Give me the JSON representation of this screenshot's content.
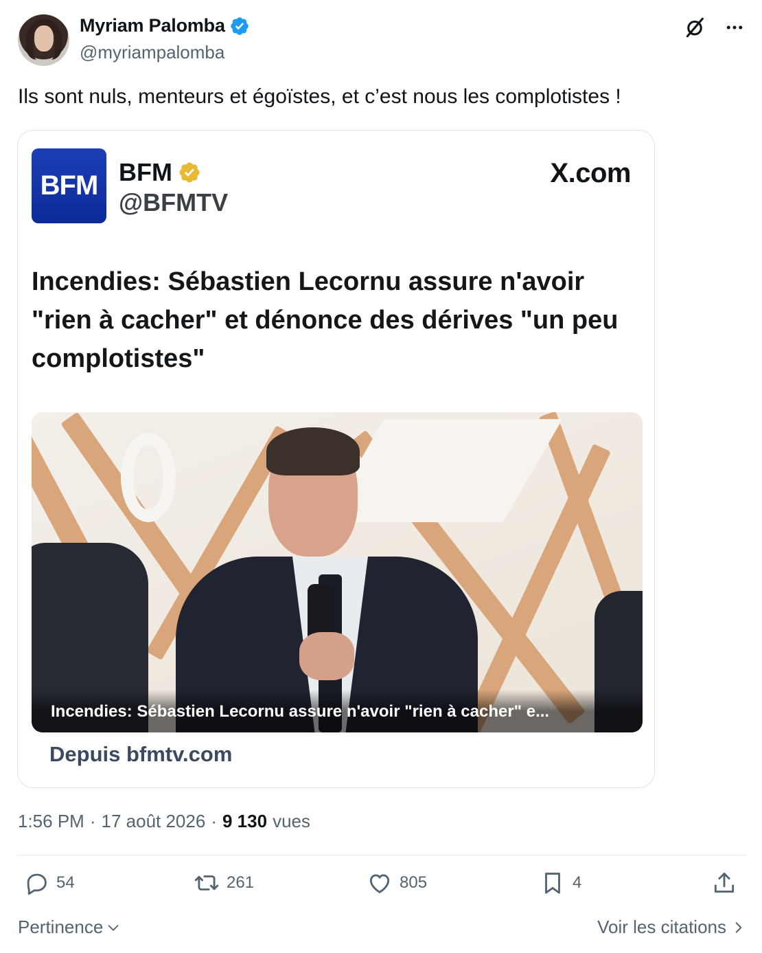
{
  "author": {
    "name": "Myriam Palomba",
    "handle": "@myriampalomba",
    "verified_color": "#1d9bf0"
  },
  "tweet": {
    "text": "Ils sont nuls, menteurs et égoïstes, et c’est nous les complotistes !"
  },
  "card": {
    "source_logo": "BFM",
    "source_name": "BFM",
    "source_handle": "@BFMTV",
    "brand": "X.com",
    "headline": "Incendies: Sébastien Lecornu assure n'avoir \"rien à cacher\" et dénonce des dérives \"un peu complotistes\"",
    "caption": "Incendies: Sébastien Lecornu assure n'avoir \"rien à cacher\" e...",
    "from_text": "Depuis bfmtv.com",
    "logo_color": "#1d3fb6",
    "gold_badge_color": "#e8b931"
  },
  "meta": {
    "time": "1:56 PM",
    "separator": "·",
    "date": "17 août 2026",
    "views_count": "9 130",
    "views_label": "vues"
  },
  "actions": {
    "replies": "54",
    "reposts": "261",
    "likes": "805",
    "bookmarks": "4"
  },
  "footer": {
    "sort_label": "Pertinence",
    "quotes_label": "Voir les citations"
  },
  "icons": [
    "grok-icon",
    "more-icon",
    "reply-icon",
    "repost-icon",
    "like-icon",
    "bookmark-icon",
    "share-icon",
    "chevron-down-icon",
    "chevron-right-icon"
  ]
}
